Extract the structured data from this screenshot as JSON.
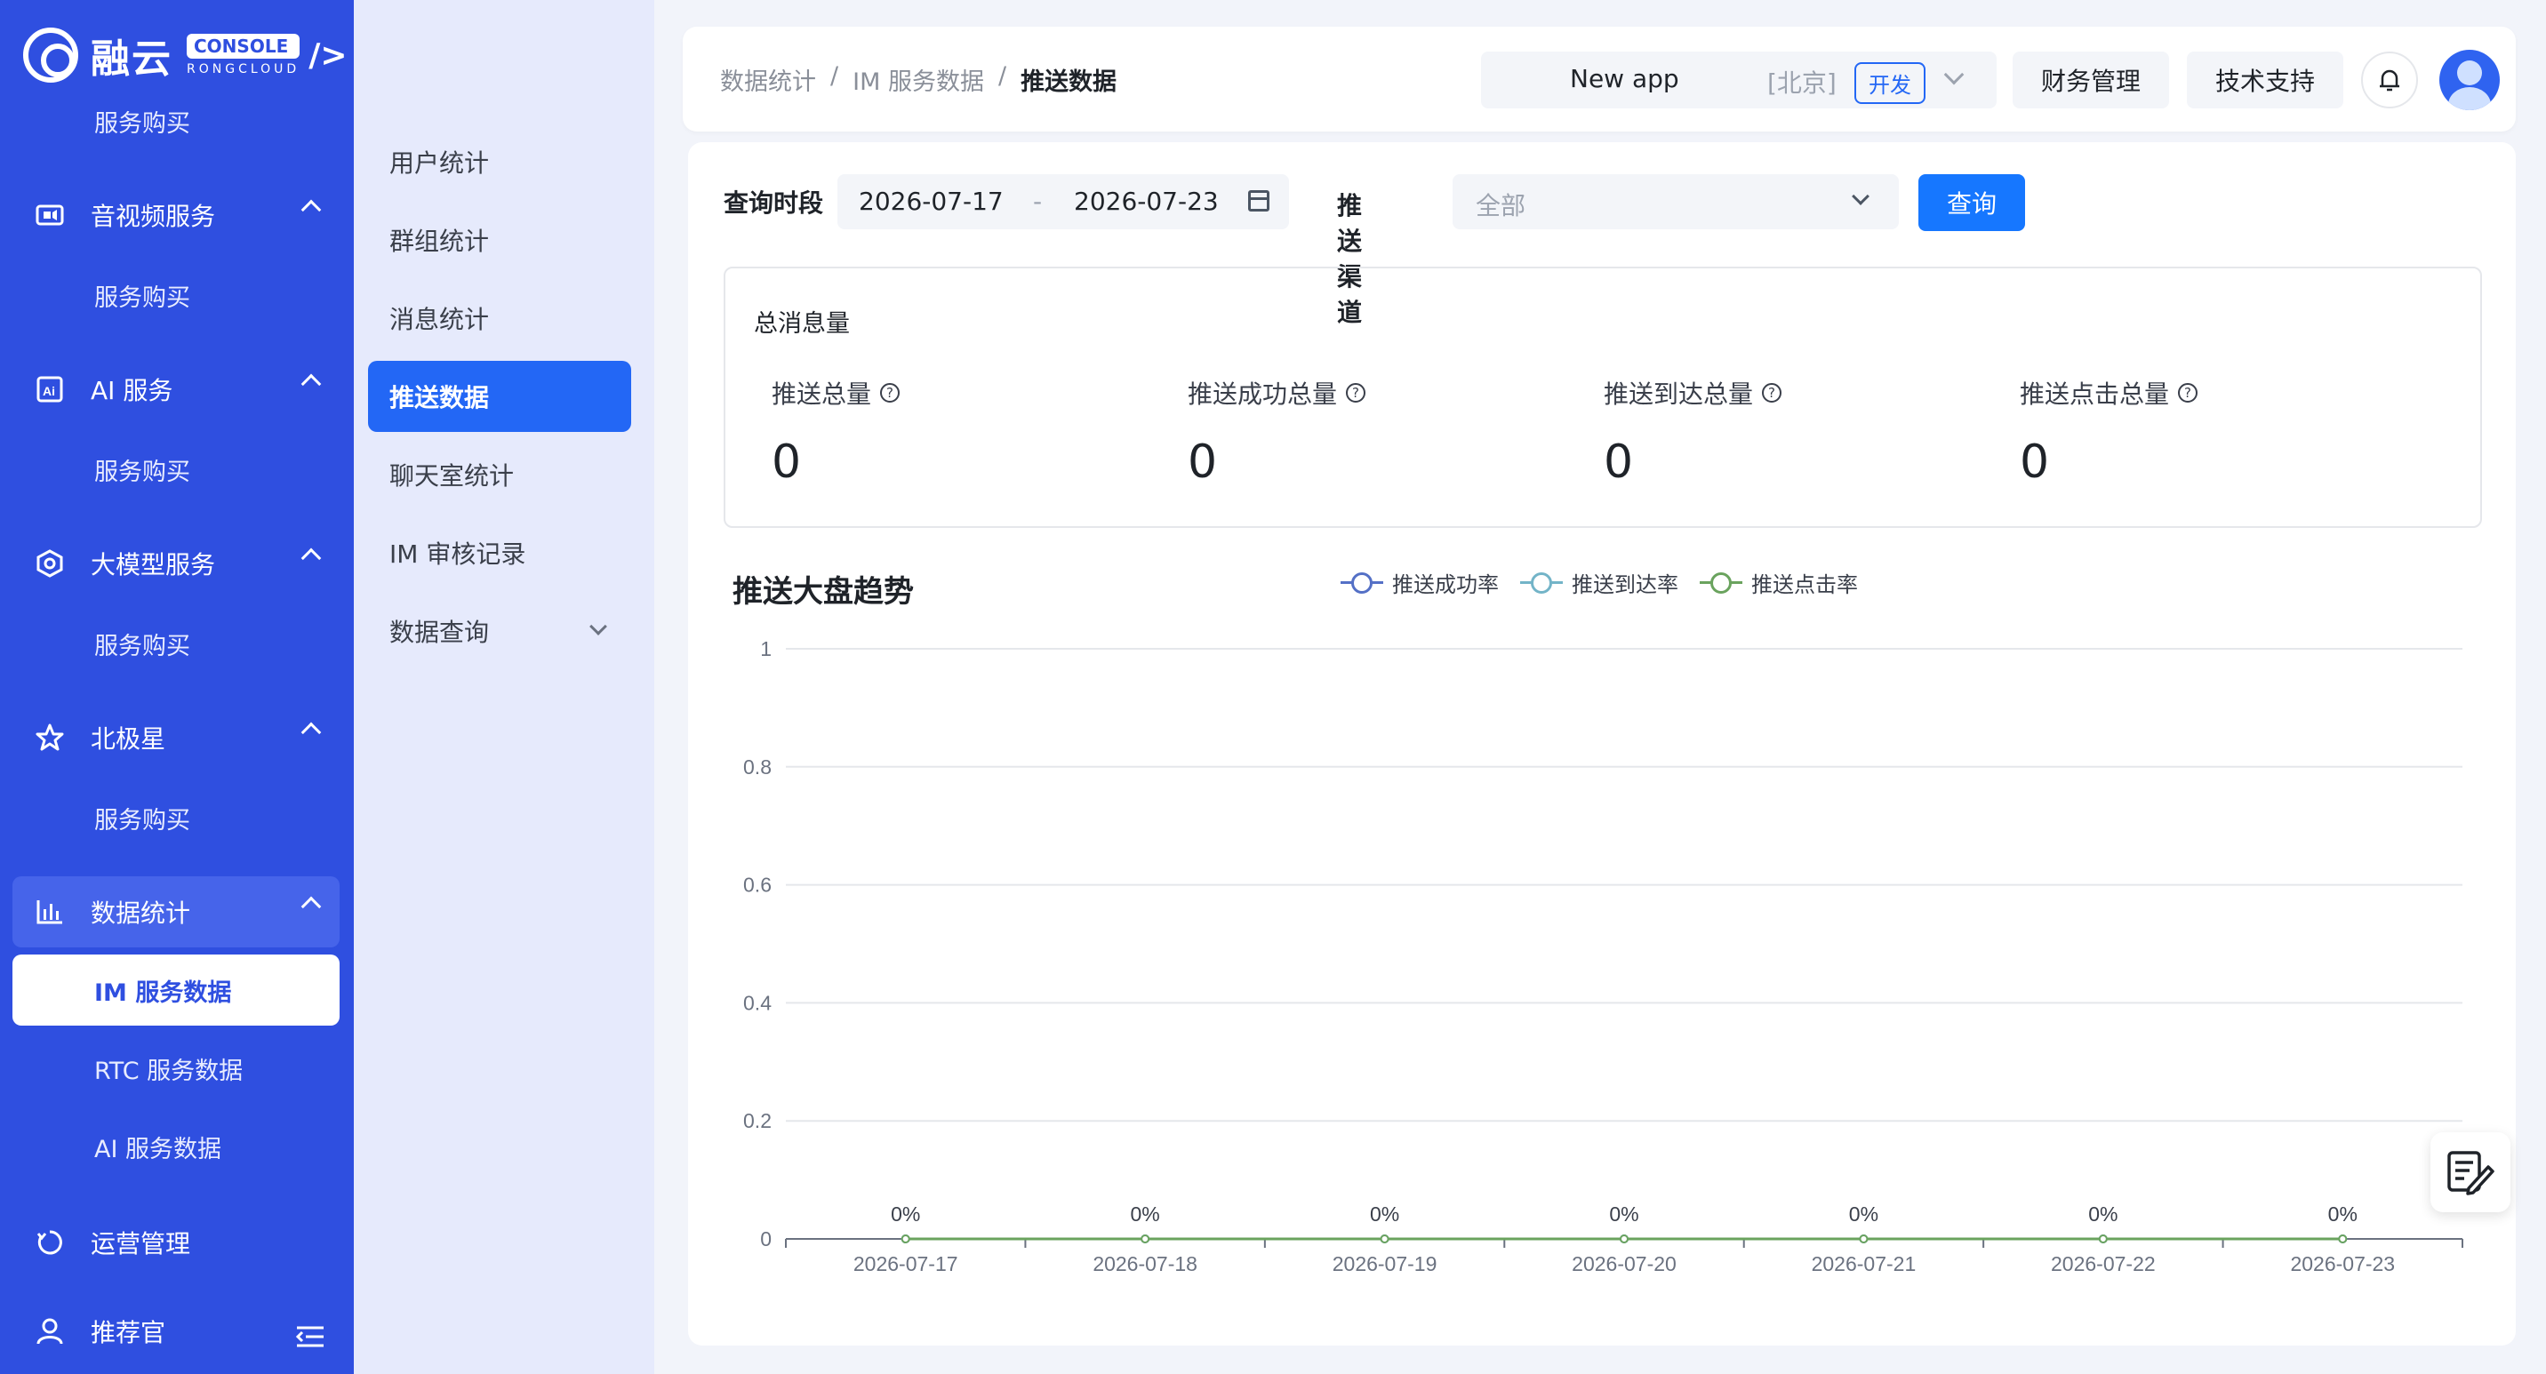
{
  "sidebar": {
    "brand": "融云",
    "brand_badge": "CONSOLE",
    "brand_sub": "RONGCLOUD",
    "top_sub_item": "服务购买",
    "groups": [
      {
        "label": "音视频服务",
        "icon": "video-icon",
        "sub": "服务购买"
      },
      {
        "label": "AI 服务",
        "icon": "ai-icon",
        "sub": "服务购买"
      },
      {
        "label": "大模型服务",
        "icon": "model-icon",
        "sub": "服务购买"
      },
      {
        "label": "北极星",
        "icon": "star-icon",
        "sub": "服务购买"
      },
      {
        "label": "数据统计",
        "icon": "bar-chart-icon",
        "subs": [
          "IM 服务数据",
          "RTC 服务数据",
          "AI 服务数据"
        ]
      }
    ],
    "ops": "运营管理",
    "referrer": "推荐官"
  },
  "subnav": {
    "items": [
      "用户统计",
      "群组统计",
      "消息统计",
      "推送数据",
      "聊天室统计",
      "IM 审核记录",
      "数据查询"
    ]
  },
  "header": {
    "breadcrumb": [
      "数据统计",
      "IM 服务数据",
      "推送数据"
    ],
    "app_name": "New app",
    "app_region": "[北京]",
    "app_env": "开发",
    "finance": "财务管理",
    "support": "技术支持"
  },
  "filters": {
    "period_label": "查询时段",
    "date_start": "2026-07-17",
    "date_sep": "-",
    "date_end": "2026-07-23",
    "channel_label": "推送渠道",
    "channel_value": "全部",
    "query_button": "查询"
  },
  "stats": {
    "title": "总消息量",
    "items": [
      {
        "label": "推送总量",
        "value": "0"
      },
      {
        "label": "推送成功总量",
        "value": "0"
      },
      {
        "label": "推送到达总量",
        "value": "0"
      },
      {
        "label": "推送点击总量",
        "value": "0"
      }
    ]
  },
  "chart_title": "推送大盘趋势",
  "colors": {
    "primary": "#2367f5",
    "sidebar": "#2f4fe0"
  },
  "chart_data": {
    "type": "line",
    "title": "推送大盘趋势",
    "x": [
      "2026-07-17",
      "2026-07-18",
      "2026-07-19",
      "2026-07-20",
      "2026-07-21",
      "2026-07-22",
      "2026-07-23"
    ],
    "yticks": [
      "0",
      "0.2",
      "0.4",
      "0.6",
      "0.8",
      "1"
    ],
    "ylim": [
      0,
      1
    ],
    "series": [
      {
        "name": "推送成功率",
        "color": "#5470c6",
        "values": [
          0,
          0,
          0,
          0,
          0,
          0,
          0
        ]
      },
      {
        "name": "推送到达率",
        "color": "#73b4c8",
        "values": [
          0,
          0,
          0,
          0,
          0,
          0,
          0
        ]
      },
      {
        "name": "推送点击率",
        "color": "#6aa35e",
        "values": [
          0,
          0,
          0,
          0,
          0,
          0,
          0
        ]
      }
    ],
    "data_labels": [
      "0%",
      "0%",
      "0%",
      "0%",
      "0%",
      "0%",
      "0%"
    ],
    "legend_position": "top-center",
    "grid": true
  }
}
